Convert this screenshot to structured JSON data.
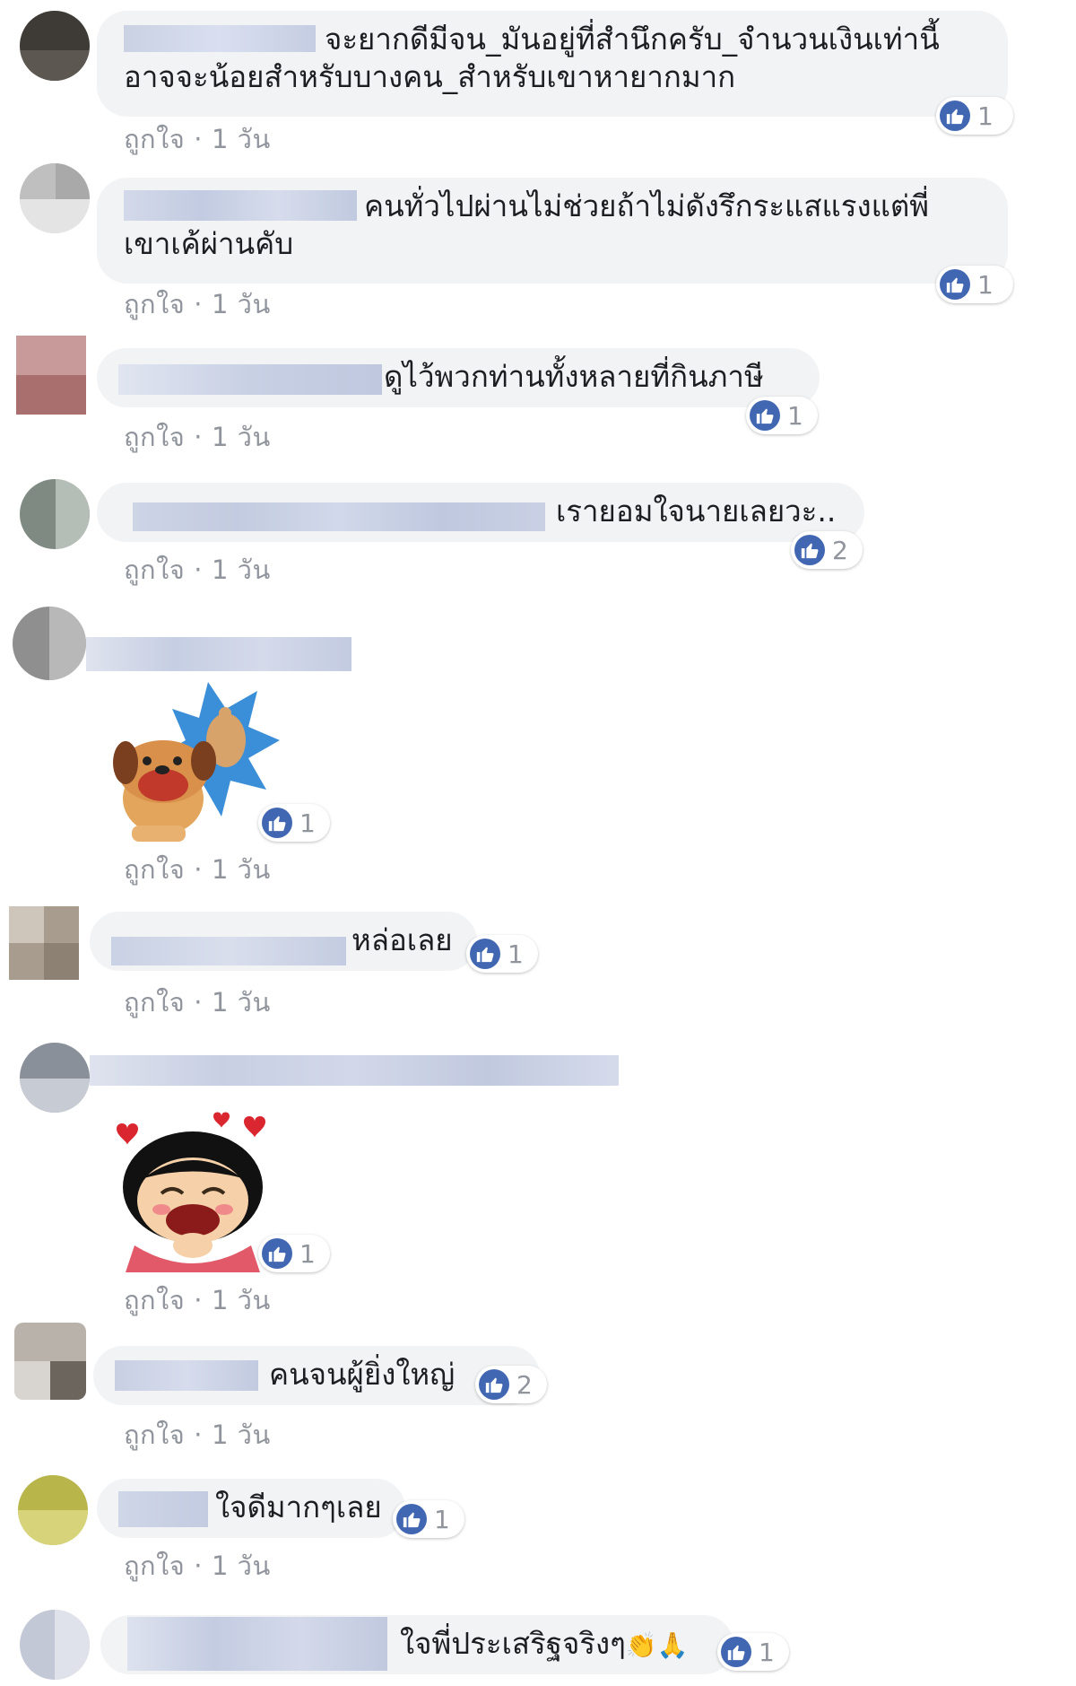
{
  "comments": [
    {
      "text": "จะยากดีมีจน_มันอยู่ที่สำนึกครับ_จำนวนเงินเท่านี้ อาจจะน้อยสำหรับบางคน_สำหรับเขาหายากมาก",
      "line1": "จะยากดีมีจน_มันอยู่ที่สำนึกครับ_จำนวนเงินเท่านี้",
      "line2": "อาจจะน้อยสำหรับบางคน_สำหรับเขาหายากมาก",
      "like_label": "ถูกใจ",
      "time": "1 วัน",
      "reaction_count": "1"
    },
    {
      "text": "คนทั่วไปผ่านไม่ช่วยถ้าไม่ดังรึกระแสแรงแต่พี่ เขาเค้ผ่านคับ",
      "line1": "คนทั่วไปผ่านไม่ช่วยถ้าไม่ดังรึกระแสแรงแต่พี่",
      "line2": "เขาเค้ผ่านคับ",
      "like_label": "ถูกใจ",
      "time": "1 วัน",
      "reaction_count": "1"
    },
    {
      "text": "ดูไว้พวกท่านทั้งหลายที่กินภาษี",
      "like_label": "ถูกใจ",
      "time": "1 วัน",
      "reaction_count": "1"
    },
    {
      "text": "เรายอมใจนายเลยวะ..",
      "like_label": "ถูกใจ",
      "time": "1 วัน",
      "reaction_count": "2"
    },
    {
      "sticker": "dog-thumbs-up-sticker",
      "like_label": "ถูกใจ",
      "time": "1 วัน",
      "reaction_count": "1"
    },
    {
      "text": "หล่อเลย",
      "like_label": "ถูกใจ",
      "time": "1 วัน",
      "reaction_count": "1"
    },
    {
      "sticker": "laughing-girl-hearts-sticker",
      "like_label": "ถูกใจ",
      "time": "1 วัน",
      "reaction_count": "1"
    },
    {
      "text": "คนจนผู้ยิ่งใหญ่",
      "like_label": "ถูกใจ",
      "time": "1 วัน",
      "reaction_count": "2"
    },
    {
      "text": "ใจดีมากๆเลย",
      "like_label": "ถูกใจ",
      "time": "1 วัน",
      "reaction_count": "1"
    },
    {
      "text": "ใจพี่ประเสริฐจริงๆ",
      "emoji": "👏🙏",
      "reaction_count": "1"
    }
  ],
  "common": {
    "dot": "·",
    "reaction_icon": "like-icon",
    "like_color": "#4267b2"
  }
}
